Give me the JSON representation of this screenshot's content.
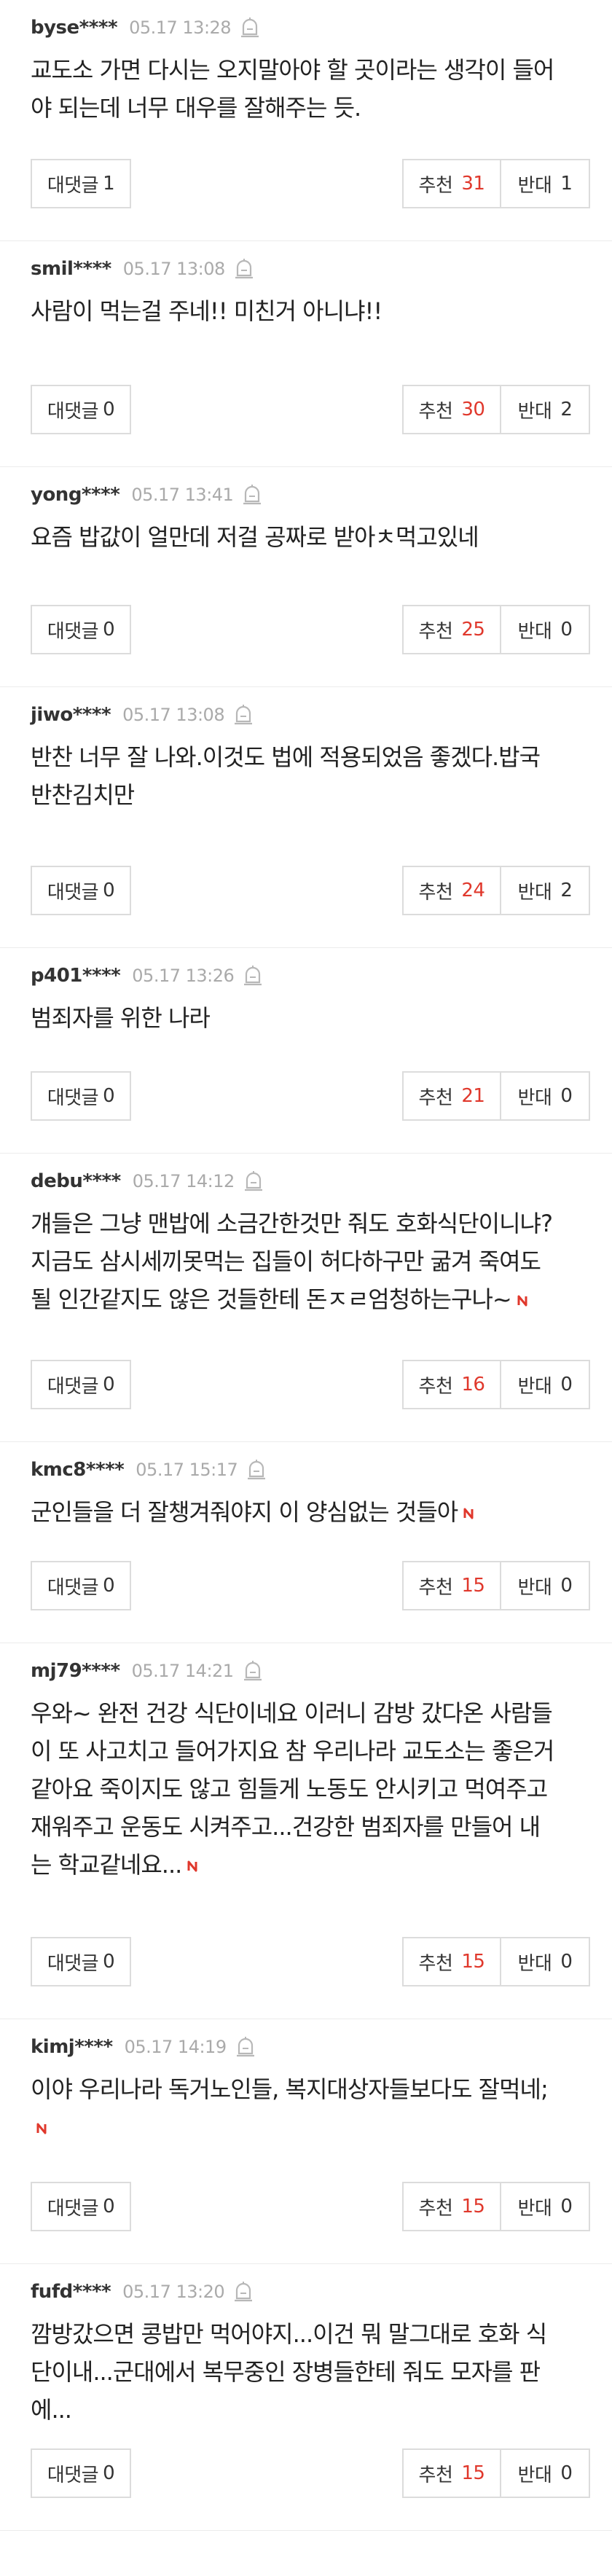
{
  "labels": {
    "reply": "대댓글",
    "upvote": "추천",
    "downvote": "반대"
  },
  "colors": {
    "upvote_count": "#e0382c",
    "badge_new": "#e0382c",
    "date": "#aaaaaa",
    "button_border": "#dcdcdc"
  },
  "comments": [
    {
      "author": "byse****",
      "date": "05.17 13:28",
      "lines": [
        "교도소 가면 다시는 오지말아야 할 곳이라는 생각이 들어",
        "야 되는데 너무 대우를 잘해주는 듯."
      ],
      "new_badge": false,
      "replies": "1",
      "upvotes": "31",
      "downvotes": "1"
    },
    {
      "author": "smil****",
      "date": "05.17 13:08",
      "lines": [
        "사람이 먹는걸 주네!! 미친거 아니냐!!"
      ],
      "new_badge": false,
      "replies": "0",
      "upvotes": "30",
      "downvotes": "2"
    },
    {
      "author": "yong****",
      "date": "05.17 13:41",
      "lines": [
        "요즘 밥값이 얼만데 저걸 공짜로 받아ㅊ먹고있네"
      ],
      "new_badge": false,
      "replies": "0",
      "upvotes": "25",
      "downvotes": "0"
    },
    {
      "author": "jiwo****",
      "date": "05.17 13:08",
      "lines": [
        "반찬 너무 잘 나와.이것도 법에 적용되었음 좋겠다.밥국",
        "반찬김치만"
      ],
      "new_badge": false,
      "replies": "0",
      "upvotes": "24",
      "downvotes": "2"
    },
    {
      "author": "p401****",
      "date": "05.17 13:26",
      "lines": [
        "범죄자를 위한 나라"
      ],
      "new_badge": false,
      "replies": "0",
      "upvotes": "21",
      "downvotes": "0"
    },
    {
      "author": "debu****",
      "date": "05.17 14:12",
      "lines": [
        "걔들은 그냥 맨밥에 소금간한것만 줘도 호화식단이니냐?",
        "지금도 삼시세끼못먹는 집들이 허다하구만 굶겨 죽여도",
        "될 인간같지도 않은 것들한테 돈ㅈㄹ엄청하는구나~"
      ],
      "new_badge": true,
      "replies": "0",
      "upvotes": "16",
      "downvotes": "0"
    },
    {
      "author": "kmc8****",
      "date": "05.17 15:17",
      "lines": [
        "군인들을 더 잘챙겨줘야지 이 양심없는 것들아"
      ],
      "new_badge": true,
      "replies": "0",
      "upvotes": "15",
      "downvotes": "0"
    },
    {
      "author": "mj79****",
      "date": "05.17 14:21",
      "lines": [
        "우와~ 완전 건강 식단이네요 이러니 감방 갔다온 사람들",
        "이 또 사고치고 들어가지요 참 우리나라 교도소는 좋은거",
        "같아요 죽이지도 않고 힘들게 노동도 안시키고 먹여주고",
        "재워주고 운동도 시켜주고...건강한 범죄자를 만들어 내",
        "는 학교같네요..."
      ],
      "new_badge": true,
      "replies": "0",
      "upvotes": "15",
      "downvotes": "0"
    },
    {
      "author": "kimj****",
      "date": "05.17 14:19",
      "lines": [
        "이야 우리나라 독거노인들, 복지대상자들보다도 잘먹네;",
        ""
      ],
      "new_badge": true,
      "replies": "0",
      "upvotes": "15",
      "downvotes": "0"
    },
    {
      "author": "fufd****",
      "date": "05.17 13:20",
      "lines": [
        "깜방갔으면 콩밥만 먹어야지...이건 뭐 말그대로 호화 식",
        "단이내...군대에서 복무중인 장병들한테 줘도 모자를 판",
        "에..."
      ],
      "new_badge": false,
      "replies": "0",
      "upvotes": "15",
      "downvotes": "0"
    }
  ]
}
